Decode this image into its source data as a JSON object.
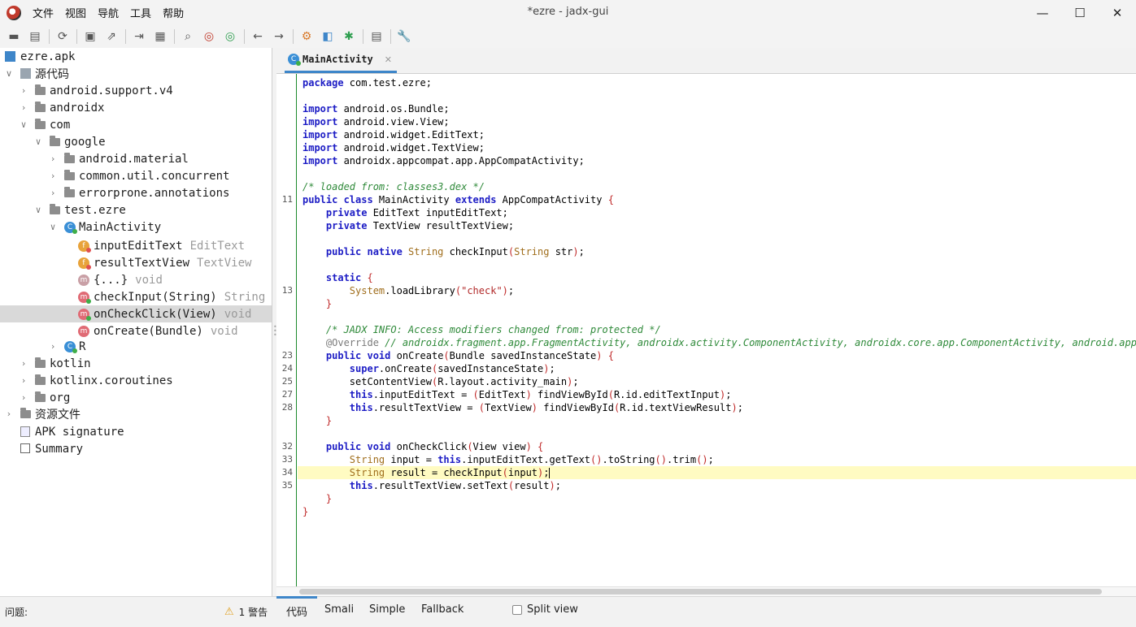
{
  "window": {
    "title": "*ezre - jadx-gui",
    "min_glyph": "—",
    "max_glyph": "☐",
    "close_glyph": "✕"
  },
  "menu": [
    "文件",
    "视图",
    "导航",
    "工具",
    "帮助"
  ],
  "toolbar_icons": [
    "open-icon",
    "add-file-icon",
    "sync-icon",
    "save-icon",
    "export-icon",
    "sync-tree-icon",
    "flatten-packages-icon",
    "search-icon",
    "find-class-icon",
    "find-usage-icon",
    "back-icon",
    "forward-icon",
    "deobfuscation-icon",
    "quark-icon",
    "debug-icon",
    "log-icon",
    "preferences-icon"
  ],
  "tree": {
    "root": "ezre.apk",
    "sources": "源代码",
    "pkg_android_support": "android.support.v4",
    "pkg_androidx": "androidx",
    "pkg_com": "com",
    "pkg_google": "google",
    "pkg_android_material": "android.material",
    "pkg_common_util": "common.util.concurrent",
    "pkg_errorprone": "errorprone.annotations",
    "pkg_test_ezre": "test.ezre",
    "cls_main": "MainActivity",
    "fld_input": "inputEditText",
    "fld_input_type": "EditText",
    "fld_result": "resultTextView",
    "fld_result_type": "TextView",
    "static_block": "{...}",
    "static_block_type": "void",
    "mth_check": "checkInput(String)",
    "mth_check_type": "String",
    "mth_click": "onCheckClick(View)",
    "mth_click_type": "void",
    "mth_create": "onCreate(Bundle)",
    "mth_create_type": "void",
    "cls_r": "R",
    "pkg_kotlin": "kotlin",
    "pkg_kotlinx": "kotlinx.coroutines",
    "pkg_org": "org",
    "resources": "资源文件",
    "apk_signature": "APK signature",
    "summary": "Summary"
  },
  "editor": {
    "tab_label": "MainActivity",
    "line_numbers": {
      "l11": "11",
      "l13": "13",
      "l23": "23",
      "l24": "24",
      "l25": "25",
      "l27": "27",
      "l28": "28",
      "l32": "32",
      "l33": "33",
      "l34": "34",
      "l35": "35"
    },
    "code": {
      "c01_kw": "package",
      "c01": " com.test.ezre;",
      "c03_kw": "import",
      "c03": " android.os.Bundle;",
      "c04_kw": "import",
      "c04": " android.view.View;",
      "c05_kw": "import",
      "c05": " android.widget.EditText;",
      "c06_kw": "import",
      "c06": " android.widget.TextView;",
      "c07_kw": "import",
      "c07": " androidx.appcompat.app.AppCompatActivity;",
      "c09": "/* loaded from: classes3.dex */",
      "c10_kw": "public class",
      "c10_a": " MainActivity ",
      "c10_kw2": "extends",
      "c10_b": " AppCompatActivity ",
      "c10_br": "{",
      "c11_kw": "private",
      "c11": " EditText inputEditText;",
      "c12_kw": "private",
      "c12": " TextView resultTextView;",
      "c14_kw": "public native",
      "c14_ty": " String",
      "c14_a": " checkInput",
      "c14_br": "(",
      "c14_ty2": "String",
      "c14_b": " str",
      "c14_br2": ")",
      "c14_c": ";",
      "c16_kw": "static",
      "c16_br": " {",
      "c17_ty": "System",
      "c17_a": ".loadLibrary",
      "c17_br": "(",
      "c17_st": "\"check\"",
      "c17_br2": ")",
      "c17_b": ";",
      "c18_br": "}",
      "c20": "/* JADX INFO: Access modifiers changed from: protected */",
      "c21_an": "@Override",
      "c21_cm": " // androidx.fragment.app.FragmentActivity, androidx.activity.ComponentActivity, androidx.core.app.ComponentActivity, android.app.Act",
      "c22_kw": "public void",
      "c22_a": " onCreate",
      "c22_br": "(",
      "c22_b": "Bundle savedInstanceState",
      "c22_br2": ")",
      "c22_br3": " {",
      "c23_kw": "super",
      "c23_a": ".onCreate",
      "c23_br": "(",
      "c23_b": "savedInstanceState",
      "c23_br2": ")",
      "c23_c": ";",
      "c24_a": "setContentView",
      "c24_br": "(",
      "c24_b": "R.layout.activity_main",
      "c24_br2": ")",
      "c24_c": ";",
      "c25_kw": "this",
      "c25_a": ".inputEditText = ",
      "c25_br": "(",
      "c25_b": "EditText",
      "c25_br2": ")",
      "c25_c": " findViewById",
      "c25_br3": "(",
      "c25_d": "R.id.editTextInput",
      "c25_br4": ")",
      "c25_e": ";",
      "c26_kw": "this",
      "c26_a": ".resultTextView = ",
      "c26_br": "(",
      "c26_b": "TextView",
      "c26_br2": ")",
      "c26_c": " findViewById",
      "c26_br3": "(",
      "c26_d": "R.id.textViewResult",
      "c26_br4": ")",
      "c26_e": ";",
      "c27_br": "}",
      "c29_kw": "public void",
      "c29_a": " onCheckClick",
      "c29_br": "(",
      "c29_b": "View view",
      "c29_br2": ")",
      "c29_br3": " {",
      "c30_ty": "String",
      "c30_a": " input = ",
      "c30_kw": "this",
      "c30_b": ".inputEditText.getText",
      "c30_br": "()",
      "c30_c": ".toString",
      "c30_br2": "()",
      "c30_d": ".trim",
      "c30_br3": "()",
      "c30_e": ";",
      "c31_ty": "String",
      "c31_a": " result = checkInput",
      "c31_br": "(",
      "c31_b": "input",
      "c31_br2": ")",
      "c31_c": ";",
      "c32_kw": "this",
      "c32_a": ".resultTextView.setText",
      "c32_br": "(",
      "c32_b": "result",
      "c32_br2": ")",
      "c32_c": ";",
      "c33_br": "}",
      "c34_br": "}"
    }
  },
  "status": {
    "problems": "问题:",
    "warnings": "1 警告",
    "tab_code": "代码",
    "tab_smali": "Smali",
    "tab_simple": "Simple",
    "tab_fallback": "Fallback",
    "split_view": "Split view"
  },
  "colors": {
    "keyword": "#1d1dc5",
    "type": "#a06e1c",
    "comment": "#2f8a3a",
    "string": "#b22a2a",
    "highlight_line": "#fffbc2",
    "accent": "#3e86c9"
  }
}
